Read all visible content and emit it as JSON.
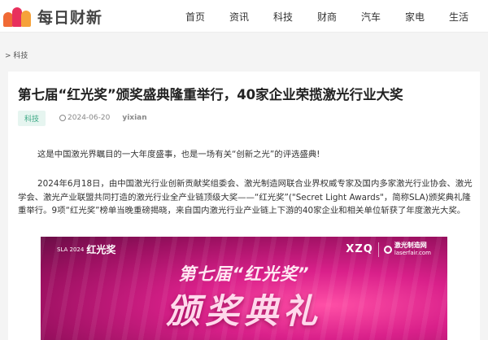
{
  "brand": {
    "name": "每日财新"
  },
  "nav": [
    "首页",
    "资讯",
    "科技",
    "财商",
    "汽车",
    "家电",
    "生活"
  ],
  "breadcrumb": "> 科技",
  "article": {
    "title": "第七届“红光奖”颁奖盛典隆重举行，40家企业荣揽激光行业大奖",
    "category": "科技",
    "date": "2024-06-20",
    "author": "yixian",
    "paragraphs": [
      "这是中国激光界瞩目的一大年度盛事，也是一场有关“创新之光”的评选盛典!",
      "2024年6月18日，由中国激光行业创新贡献奖组委会、激光制造网联合业界权威专家及国内多家激光行业协会、激光学会、激光产业联盟共同打造的激光行业全产业链顶级大奖——“红光奖”(\"Secret Light Awards\"，简称SLA)颁奖典礼隆重举行。9项“红光奖”榜单当晚重磅揭晓，来自国内激光行业产业链上下游的40家企业和相关单位斩获了年度激光大奖。"
    ],
    "banner": {
      "left_logo_small": "SLA 2024",
      "left_logo": "红光奖",
      "right_logo": "XZQ",
      "right_brand": "激光制造网",
      "right_url": "laserfair.com",
      "subtitle": "第七届“红光奖”",
      "main": "颁奖典礼"
    }
  }
}
